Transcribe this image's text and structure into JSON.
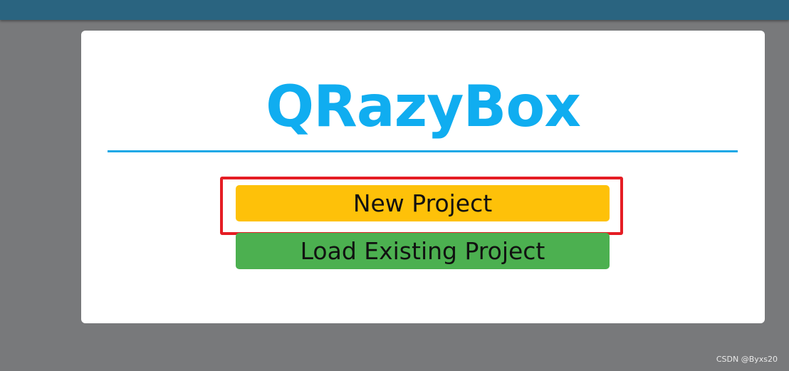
{
  "app": {
    "logo_text": "QRazyBox"
  },
  "menu": {
    "new_project_label": "New Project",
    "load_project_label": "Load Existing Project"
  },
  "watermark": {
    "text": "CSDN @Byxs20"
  },
  "colors": {
    "top_bar": "#2a6480",
    "overlay": "#78797b",
    "logo": "#10adf0",
    "new_project_button": "#fec109",
    "load_project_button": "#4cb050",
    "highlight_box": "#e51d24"
  }
}
